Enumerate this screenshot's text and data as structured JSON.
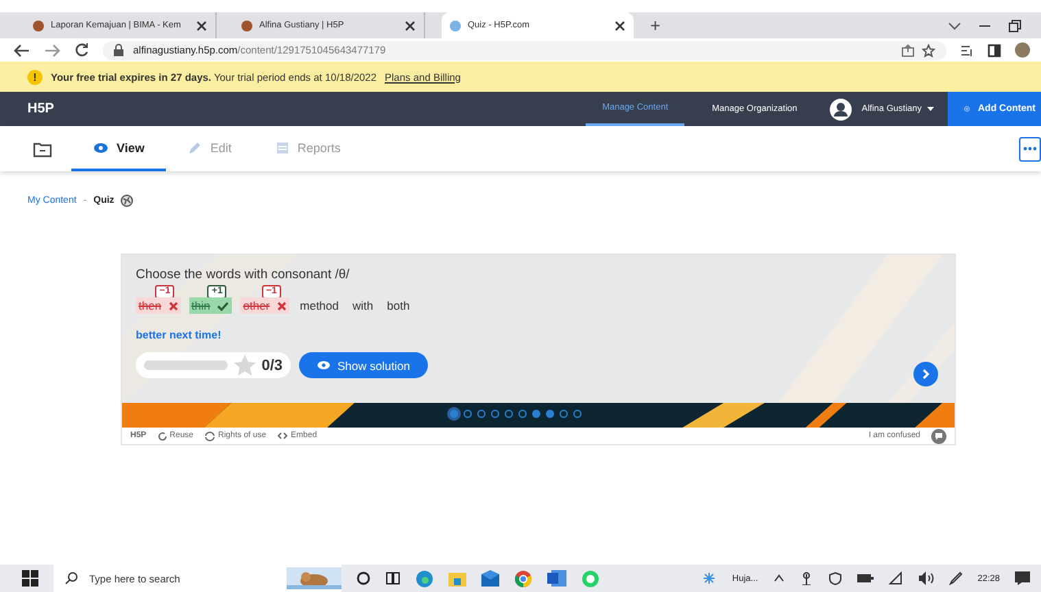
{
  "browser": {
    "tabs": [
      {
        "title": "Laporan Kemajuan | BIMA - Kem",
        "selected": false
      },
      {
        "title": "Alfina Gustiany | H5P",
        "selected": false
      },
      {
        "title": "Quiz - H5P.com",
        "selected": true
      }
    ],
    "new_tab": "+",
    "url_host": "alfinagustiany.h5p.com",
    "url_path": "/content/1291751045643477179"
  },
  "banner": {
    "icon": "!",
    "bold": "Your free trial expires in 27 days.",
    "text": "Your trial period ends at 10/18/2022",
    "link": "Plans and Billing"
  },
  "topbar": {
    "logo": "H5P",
    "nav": [
      {
        "label": "Manage Content",
        "selected": true
      },
      {
        "label": "Manage Organization",
        "selected": false
      }
    ],
    "user": "Alfina Gustiany",
    "add_button": "Add Content"
  },
  "subtabs": [
    {
      "label": "View",
      "selected": true
    },
    {
      "label": "Edit",
      "selected": false
    },
    {
      "label": "Reports",
      "selected": false
    }
  ],
  "breadcrumb": {
    "parent": "My Content",
    "separator": "-",
    "current": "Quiz"
  },
  "quiz": {
    "question": "Choose the words with consonant /θ/",
    "words": [
      {
        "text": "then",
        "kind": "wrong",
        "score": "−1"
      },
      {
        "text": "thin",
        "kind": "correct",
        "score": "+1"
      },
      {
        "text": "other",
        "kind": "wrong",
        "score": "−1"
      },
      {
        "text": "method",
        "kind": "plain"
      },
      {
        "text": "with",
        "kind": "plain"
      },
      {
        "text": "both",
        "kind": "plain"
      }
    ],
    "feedback": "better next time!",
    "progress": {
      "level": 0,
      "score": "0/3"
    },
    "solution_button": "Show solution",
    "dots": [
      {
        "selected": true,
        "answered": false
      },
      {
        "selected": false,
        "answered": false
      },
      {
        "selected": false,
        "answered": false
      },
      {
        "selected": false,
        "answered": false
      },
      {
        "selected": false,
        "answered": false
      },
      {
        "selected": false,
        "answered": false
      },
      {
        "selected": false,
        "answered": true
      },
      {
        "selected": false,
        "answered": true
      },
      {
        "selected": false,
        "answered": false
      },
      {
        "selected": false,
        "answered": false
      }
    ],
    "footer": {
      "logo": "H5P",
      "actions": [
        "Reuse",
        "Rights of use",
        "Embed"
      ],
      "confused": "I am confused"
    }
  },
  "taskbar": {
    "search_placeholder": "Type here to search",
    "weather": "Huja...",
    "time": "22:28"
  }
}
